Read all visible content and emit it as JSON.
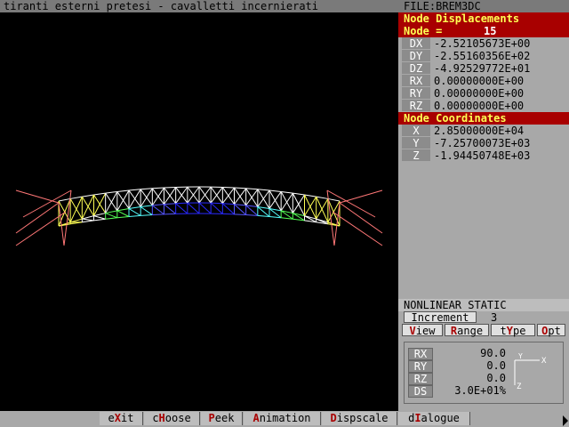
{
  "title": "tiranti esterni pretesi - cavalletti incernierati",
  "file_label": "FILE:BREM3DC",
  "displacements": {
    "header": "Node Displacements",
    "node_label": "Node =",
    "node_value": "15",
    "rows": [
      {
        "k": "DX",
        "v": "-2.52105673E+00"
      },
      {
        "k": "DY",
        "v": "-2.55160356E+02"
      },
      {
        "k": "DZ",
        "v": "-4.92529772E+01"
      },
      {
        "k": "RX",
        "v": " 0.00000000E+00"
      },
      {
        "k": "RY",
        "v": " 0.00000000E+00"
      },
      {
        "k": "RZ",
        "v": " 0.00000000E+00"
      }
    ]
  },
  "coordinates": {
    "header": "Node Coordinates",
    "rows": [
      {
        "k": "X",
        "v": " 2.85000000E+04"
      },
      {
        "k": "Y",
        "v": "-7.25700073E+03"
      },
      {
        "k": "Z",
        "v": "-1.94450748E+03"
      }
    ]
  },
  "analysis": "NONLINEAR STATIC",
  "increment_label": "Increment",
  "increment_value": "3",
  "tabs": [
    {
      "pre": "",
      "hot": "V",
      "post": "iew"
    },
    {
      "pre": "",
      "hot": "R",
      "post": "ange"
    },
    {
      "pre": "t",
      "hot": "Y",
      "post": "pe"
    },
    {
      "pre": "",
      "hot": "O",
      "post": "pt"
    }
  ],
  "view": [
    {
      "k": "RX",
      "v": "90.0"
    },
    {
      "k": "RY",
      "v": "0.0"
    },
    {
      "k": "RZ",
      "v": "0.0"
    },
    {
      "k": "DS",
      "v": "3.0E+01%"
    }
  ],
  "axes": {
    "y": "Y",
    "x": "X",
    "z": "Z"
  },
  "menu": [
    {
      "pre": "e",
      "hot": "X",
      "post": "it"
    },
    {
      "pre": "c",
      "hot": "H",
      "post": "oose"
    },
    {
      "pre": "",
      "hot": "P",
      "post": "eek"
    },
    {
      "pre": "",
      "hot": "A",
      "post": "nimation"
    },
    {
      "pre": "",
      "hot": "D",
      "post": "ispscale"
    },
    {
      "pre": "d",
      "hot": "I",
      "post": "alogue"
    }
  ],
  "colors": {
    "red": "#a80000",
    "yellow": "#ffff54",
    "panel": "#a8a8a8"
  }
}
